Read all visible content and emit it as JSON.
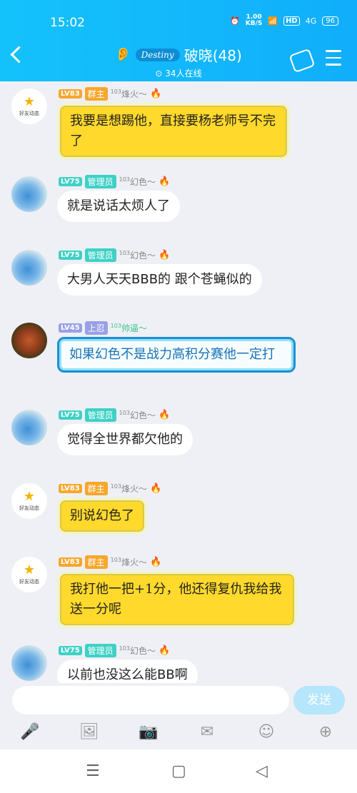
{
  "status_bar": {
    "time": "15:02",
    "net_speed_value": "1.00",
    "net_speed_unit": "KB/S",
    "hd_label": "HD",
    "signal_label": "4G",
    "battery": "96"
  },
  "header": {
    "badge_text": "Destiny",
    "group_name": "破晓(48)",
    "online_text": "34人在线"
  },
  "messages": [
    {
      "level": "LV83",
      "role": "群主",
      "title_num": "103",
      "title": "烽火",
      "avatar_label": "好友动态",
      "text": "我要是想踢他，直接要杨老师号不完了"
    },
    {
      "level": "LV75",
      "role": "管理员",
      "title_num": "103",
      "title": "幻色",
      "text": "就是说话太烦人了"
    },
    {
      "level": "LV75",
      "role": "管理员",
      "title_num": "103",
      "title": "幻色",
      "text": "大男人天天BBB的 跟个苍蝇似的"
    },
    {
      "level": "LV45",
      "role": "上忍",
      "title_num": "103",
      "title": "帅逼",
      "text": "如果幻色不是战力高积分赛他一定打"
    },
    {
      "level": "LV75",
      "role": "管理员",
      "title_num": "103",
      "title": "幻色",
      "text": "觉得全世界都欠他的"
    },
    {
      "level": "LV83",
      "role": "群主",
      "title_num": "103",
      "title": "烽火",
      "avatar_label": "好友动态",
      "text": "别说幻色了"
    },
    {
      "level": "LV83",
      "role": "群主",
      "title_num": "103",
      "title": "烽火",
      "avatar_label": "好友动态",
      "text": "我打他一把+1分，他还得复仇我给我送一分呢"
    },
    {
      "level": "LV75",
      "role": "管理员",
      "title_num": "103",
      "title": "幻色",
      "text": "以前也没这么能BB啊"
    }
  ],
  "input": {
    "send_label": "发送"
  },
  "icons": {
    "toolbar": [
      "microphone-icon",
      "image-icon",
      "camera-icon",
      "red-packet-icon",
      "emoji-icon",
      "plus-icon"
    ],
    "nav": [
      "recents-icon",
      "home-icon",
      "back-icon"
    ]
  }
}
